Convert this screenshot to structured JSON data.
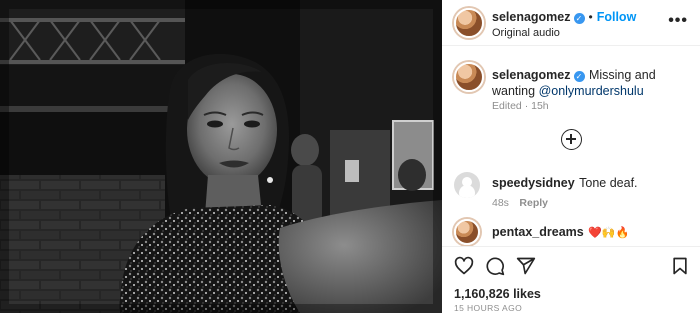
{
  "header": {
    "username": "selenagomez",
    "verified_mark": "✓",
    "separator": "•",
    "follow_label": "Follow",
    "audio_label": "Original audio",
    "more_label": "•••"
  },
  "caption": {
    "username": "selenagomez",
    "text_prefix": "Missing and wanting ",
    "mention": "@onlymurdershulu",
    "meta": "Edited · 15h"
  },
  "comments": [
    {
      "username": "speedysidney",
      "text": "Tone deaf.",
      "time": "48s",
      "reply_label": "Reply"
    },
    {
      "username": "pentax_dreams",
      "text": "❤️🙌🔥"
    }
  ],
  "actions": {
    "icons": [
      "heart-icon",
      "comment-icon",
      "share-icon",
      "bookmark-icon"
    ]
  },
  "likes_text": "1,160,826 likes",
  "timestamp": "15 HOURS AGO",
  "colors": {
    "link": "#0095f6",
    "mention": "#00376b",
    "verified": "#3897f0",
    "muted": "#8e8e8e"
  }
}
